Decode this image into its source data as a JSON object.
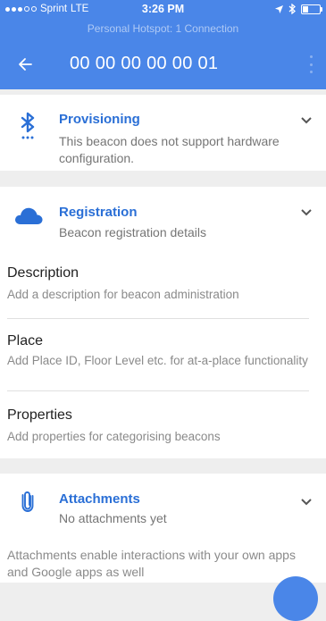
{
  "status_bar": {
    "carrier": "Sprint",
    "network": "LTE",
    "time": "3:26 PM",
    "hotspot": "Personal Hotspot: 1 Connection"
  },
  "app_bar": {
    "title": "00 00 00 00 00 01",
    "back_icon": "arrow-back-icon"
  },
  "provisioning": {
    "title": "Provisioning",
    "subtitle": "This beacon does not support hardware configuration.",
    "icon": "bluetooth-searching-icon"
  },
  "registration": {
    "title": "Registration",
    "subtitle": "Beacon registration details",
    "icon": "cloud-icon",
    "sections": [
      {
        "title": "Description",
        "desc": "Add a description for beacon administration"
      },
      {
        "title": "Place",
        "desc": "Add Place ID, Floor Level etc. for at-a-place functionality"
      },
      {
        "title": "Properties",
        "desc": "Add properties for categorising beacons"
      }
    ]
  },
  "attachments": {
    "title": "Attachments",
    "subtitle": "No attachments yet",
    "body": "Attachments enable interactions with your own apps and Google apps as well",
    "icon": "attachment-icon"
  },
  "colors": {
    "primary": "#4a86e8",
    "accent_text": "#2a6fd6",
    "background": "#eeeeee"
  }
}
